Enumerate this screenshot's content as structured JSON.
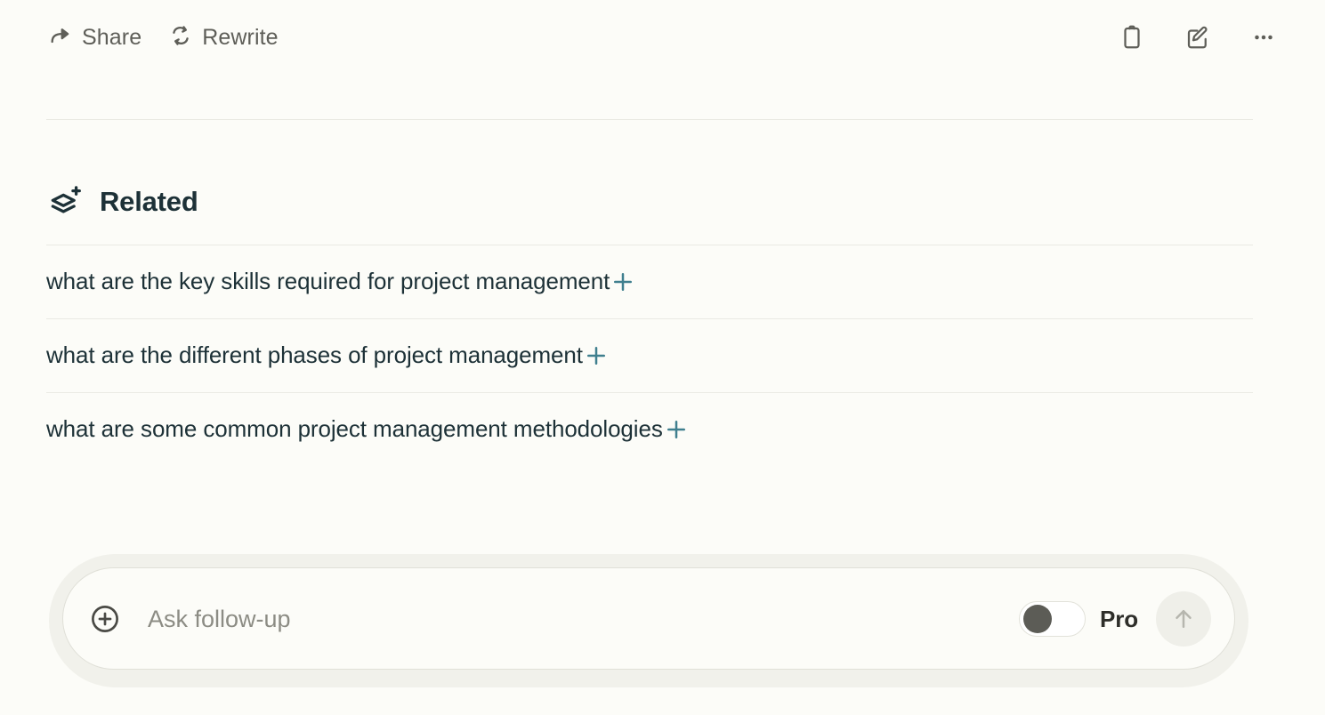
{
  "theme": {
    "background": "#fcfcf8",
    "text_primary": "#1d3137",
    "text_muted": "#5e5e58",
    "divider": "#e7e7e0",
    "accent_teal": "#3f7f8e",
    "halo": "#f1f1eb",
    "toggle_knob": "#5c5c56",
    "submit_bg": "#efefe9",
    "submit_arrow": "#b6b6ae"
  },
  "action_bar": {
    "share": {
      "label": "Share",
      "icon": "share-arrow-icon"
    },
    "rewrite": {
      "label": "Rewrite",
      "icon": "rewrite-refresh-icon"
    },
    "right_icons": [
      {
        "name": "copy-clipboard-icon"
      },
      {
        "name": "edit-pencil-square-icon"
      },
      {
        "name": "more-ellipsis-icon"
      }
    ]
  },
  "related": {
    "title": "Related",
    "icon": "layers-plus-icon",
    "items": [
      {
        "question": "what are the key skills required for project management",
        "add_icon": "plus-icon"
      },
      {
        "question": "what are the different phases of project management",
        "add_icon": "plus-icon"
      },
      {
        "question": "what are some common project management methodologies",
        "add_icon": "plus-icon"
      }
    ]
  },
  "composer": {
    "attach_icon": "plus-circle-icon",
    "placeholder": "Ask follow-up",
    "value": "",
    "pro_label": "Pro",
    "pro_enabled": false,
    "submit_icon": "arrow-up-icon"
  }
}
